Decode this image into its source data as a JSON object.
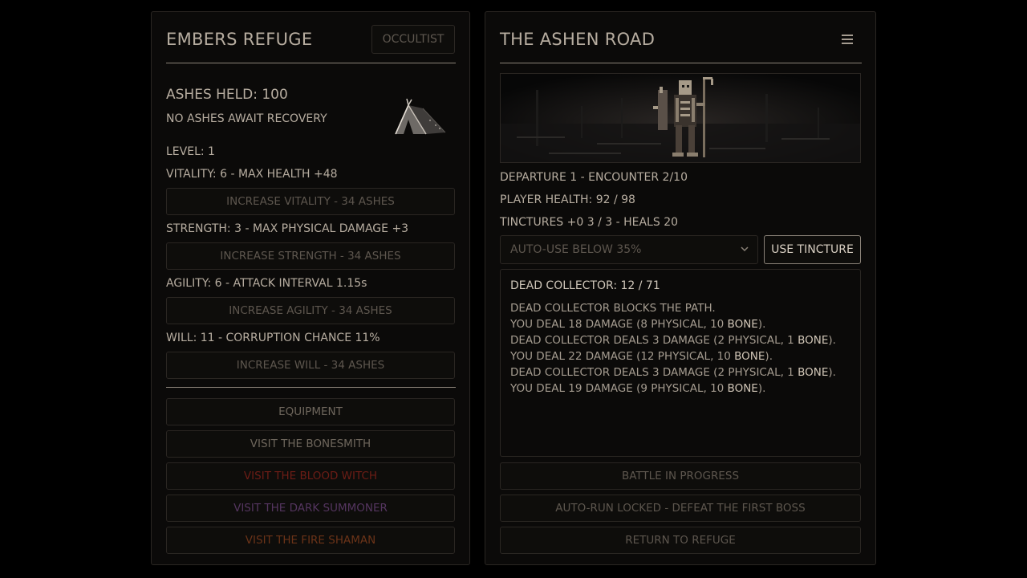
{
  "refuge": {
    "title": "EMBERS REFUGE",
    "class_badge": "OCCULTIST",
    "ashes_held": "ASHES HELD: 100",
    "ashes_recovery": "NO ASHES AWAIT RECOVERY",
    "level": "LEVEL: 1",
    "vitality": "VITALITY: 6 - MAX HEALTH +48",
    "vitality_button": "INCREASE VITALITY - 34 ASHES",
    "strength": "STRENGTH: 3 - MAX PHYSICAL DAMAGE +3",
    "strength_button": "INCREASE STRENGTH - 34 ASHES",
    "agility": "AGILITY: 6 - ATTACK INTERVAL 1.15s",
    "agility_button": "INCREASE AGILITY - 34 ASHES",
    "will": "WILL: 11 - CORRUPTION CHANCE 11%",
    "will_button": "INCREASE WILL - 34 ASHES",
    "menu": {
      "equipment": "EQUIPMENT",
      "bonesmith": "VISIT THE BONESMITH",
      "blood_witch": "VISIT THE BLOOD WITCH",
      "dark_summoner": "VISIT THE DARK SUMMONER",
      "fire_shaman": "VISIT THE FIRE SHAMAN"
    }
  },
  "road": {
    "title": "THE ASHEN ROAD",
    "departure": "DEPARTURE 1 - ENCOUNTER 2/10",
    "player_health": "PLAYER HEALTH: 92 / 98",
    "tinctures": "TINCTURES +0  3 / 3 - HEALS 20",
    "auto_use_selected": "AUTO-USE BELOW 35%",
    "use_tincture": "USE TINCTURE",
    "enemy": "DEAD COLLECTOR: 12 / 71",
    "log": [
      {
        "text": "DEAD COLLECTOR BLOCKS THE PATH."
      },
      {
        "pre": "YOU DEAL 18 DAMAGE (8 PHYSICAL, 10 ",
        "hl": "BONE",
        "post": ")."
      },
      {
        "pre": "DEAD COLLECTOR DEALS 3 DAMAGE (2 PHYSICAL, 1 ",
        "hl": "BONE",
        "post": ")."
      },
      {
        "pre": "YOU DEAL 22 DAMAGE (12 PHYSICAL, 10 ",
        "hl": "BONE",
        "post": ")."
      },
      {
        "pre": "DEAD COLLECTOR DEALS 3 DAMAGE (2 PHYSICAL, 1 ",
        "hl": "BONE",
        "post": ")."
      },
      {
        "pre": "YOU DEAL 19 DAMAGE (9 PHYSICAL, 10 ",
        "hl": "BONE",
        "post": ")."
      }
    ],
    "battle_status": "BATTLE IN PROGRESS",
    "auto_run": "AUTO-RUN LOCKED - DEFEAT THE FIRST BOSS",
    "return": "RETURN TO REFUGE"
  },
  "icons": {
    "camp": "tent-icon",
    "menu": "hamburger-menu-icon",
    "dropdown": "chevron-down-icon",
    "scene": "undead-enemy-illustration"
  },
  "colors": {
    "blood_witch": "#6d1d16",
    "dark_summoner": "#54355f",
    "fire_shaman": "#6b3318"
  }
}
